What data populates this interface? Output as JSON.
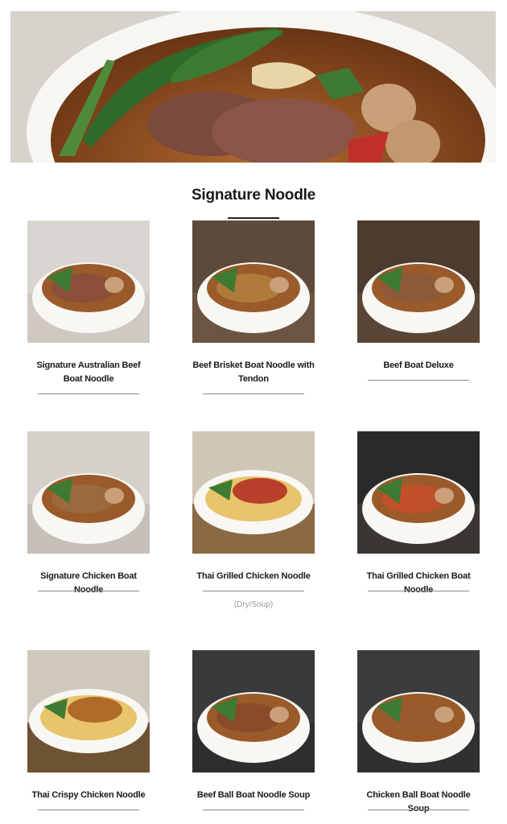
{
  "hero": {
    "image": "beef-boat-noodle-hero-photo"
  },
  "section": {
    "title": "Signature Noodle"
  },
  "items": [
    {
      "name": "Signature Australian Beef Boat Noodle",
      "note": "",
      "image": "beef-noodle-bowl",
      "accent": "#8a4e3a"
    },
    {
      "name": "Beef Brisket Boat Noodle with Tendon",
      "note": "",
      "image": "brisket-noodle-bowl",
      "accent": "#b07a3a"
    },
    {
      "name": "Beef Boat Deluxe",
      "note": "",
      "image": "deluxe-noodle-bowl",
      "accent": "#8a5a3a"
    },
    {
      "name": "Signature Chicken Boat Noodle",
      "note": "",
      "image": "chicken-noodle-bowl",
      "accent": "#9a6a3e"
    },
    {
      "name": "Thai Grilled Chicken Noodle",
      "note": "(Dry/Soup)",
      "image": "grilled-chicken-noodle-plate",
      "accent": "#b8402a"
    },
    {
      "name": "Thai Grilled Chicken Boat Noodle",
      "note": "",
      "image": "grilled-chicken-boat-bowl",
      "accent": "#c0502a"
    },
    {
      "name": "Thai Crispy Chicken Noodle",
      "note": "",
      "image": "crispy-chicken-noodle-plate",
      "accent": "#b06a2a"
    },
    {
      "name": "Beef Ball Boat Noodle Soup",
      "note": "",
      "image": "beef-ball-soup-bowl",
      "accent": "#8a4a2a"
    },
    {
      "name": "Chicken Ball Boat Noodle Soup",
      "note": "",
      "image": "chicken-ball-soup-bowl",
      "accent": "#9a5a2e"
    }
  ]
}
